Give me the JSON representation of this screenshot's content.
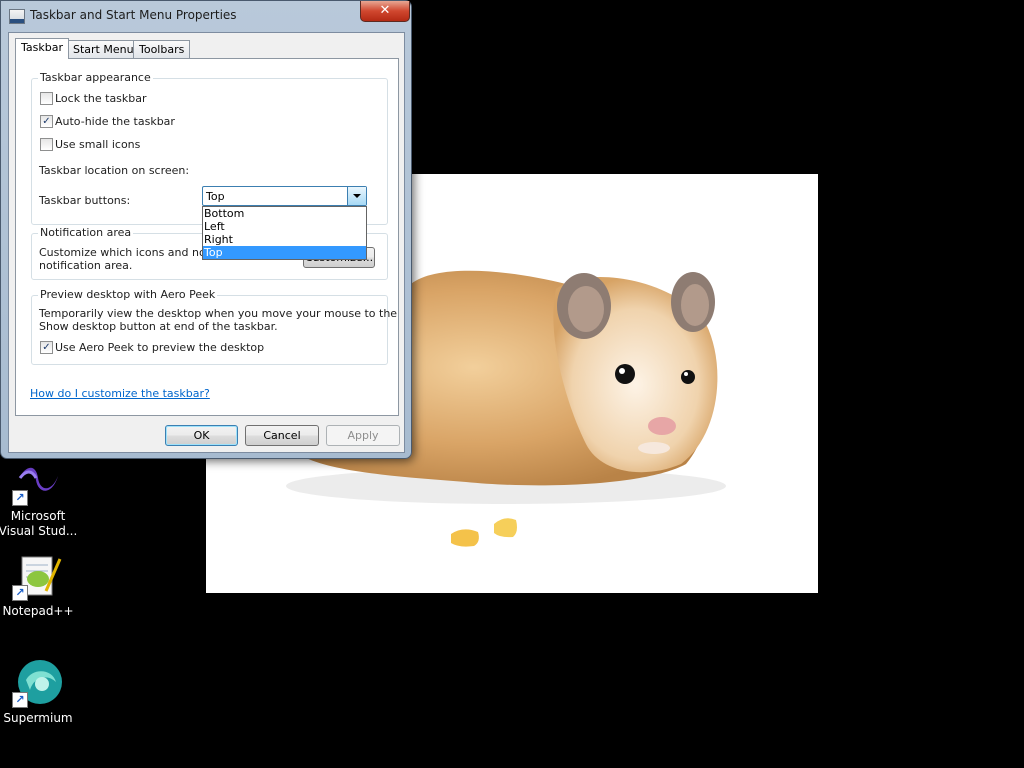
{
  "window": {
    "title": "Taskbar and Start Menu Properties",
    "close_glyph": "✕"
  },
  "tabs": [
    {
      "label": "Taskbar",
      "active": true
    },
    {
      "label": "Start Menu",
      "active": false
    },
    {
      "label": "Toolbars",
      "active": false
    }
  ],
  "taskbar_appearance": {
    "group_title": "Taskbar appearance",
    "lock": {
      "label": "Lock the taskbar",
      "checked": false
    },
    "autohide": {
      "label": "Auto-hide the taskbar",
      "checked": true
    },
    "small_icons": {
      "label": "Use small icons",
      "checked": false
    },
    "location_label": "Taskbar location on screen:",
    "location_value": "Top",
    "location_options": [
      "Bottom",
      "Left",
      "Right",
      "Top"
    ],
    "buttons_label": "Taskbar buttons:"
  },
  "notification_area": {
    "group_title": "Notification area",
    "desc_line1": "Customize which icons and notifications appear in the",
    "desc_line2": "notification area.",
    "customize_button": "Customize..."
  },
  "aero_peek": {
    "group_title": "Preview desktop with Aero Peek",
    "desc_line1": "Temporarily view the desktop when you move your mouse to the",
    "desc_line2": "Show desktop button at end of the taskbar.",
    "use_peek": {
      "label": "Use Aero Peek to preview the desktop",
      "checked": true
    }
  },
  "help_link": "How do I customize the taskbar?",
  "footer": {
    "ok": "OK",
    "cancel": "Cancel",
    "apply": "Apply"
  },
  "desktop_icons": [
    {
      "label_line1": "Microsoft",
      "label_line2": "Visual Stud...",
      "icon": "visual-studio-icon"
    },
    {
      "label_line1": "Notepad++",
      "label_line2": "",
      "icon": "notepad-plus-plus-icon"
    },
    {
      "label_line1": "Supermium",
      "label_line2": "",
      "icon": "supermium-icon"
    }
  ],
  "shortcut_glyph": "↗",
  "check_glyph": "✓",
  "colors": {
    "desktop_bg": "#000000",
    "selection": "#3399ff",
    "link": "#0066cc"
  }
}
